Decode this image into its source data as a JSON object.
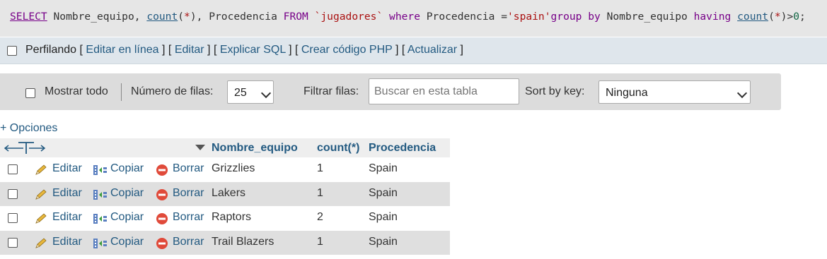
{
  "sql": {
    "select_kw": "SELECT",
    "cols_1": " Nombre_equipo, ",
    "count_fn": "count",
    "paren_open": "(",
    "star": "*",
    "paren_close": ")",
    "cols_2": ", Procedencia ",
    "from_kw": "FROM",
    "table_name": " `jugadores` ",
    "where_kw": "where",
    "where_col": " Procedencia =",
    "where_val": "'spain'",
    "group_kw": "group by",
    "group_col": " Nombre_equipo ",
    "having_kw": "having",
    "gt": ">",
    "zero": "0",
    "semicolon": ";"
  },
  "profiling": {
    "label": "Perfilando",
    "links": [
      "Editar en línea",
      "Editar",
      "Explicar SQL",
      "Crear código PHP",
      "Actualizar"
    ]
  },
  "nav": {
    "show_all_label": "Mostrar todo",
    "rows_label": "Número de filas:",
    "rows_value": "25",
    "filter_label": "Filtrar filas:",
    "filter_placeholder": "Buscar en esta tabla",
    "sort_label": "Sort by key:",
    "sort_value": "Ninguna"
  },
  "options_link": "+ Opciones",
  "table": {
    "columns": [
      "Nombre_equipo",
      "count(*)",
      "Procedencia"
    ],
    "actions": {
      "edit": "Editar",
      "copy": "Copiar",
      "delete": "Borrar"
    },
    "rows": [
      {
        "team": "Grizzlies",
        "count": "1",
        "origin": "Spain"
      },
      {
        "team": "Lakers",
        "count": "1",
        "origin": "Spain"
      },
      {
        "team": "Raptors",
        "count": "2",
        "origin": "Spain"
      },
      {
        "team": "Trail Blazers",
        "count": "1",
        "origin": "Spain"
      }
    ]
  },
  "colors": {
    "link": "#235a81",
    "keyword": "#770088",
    "string": "#aa1111"
  }
}
